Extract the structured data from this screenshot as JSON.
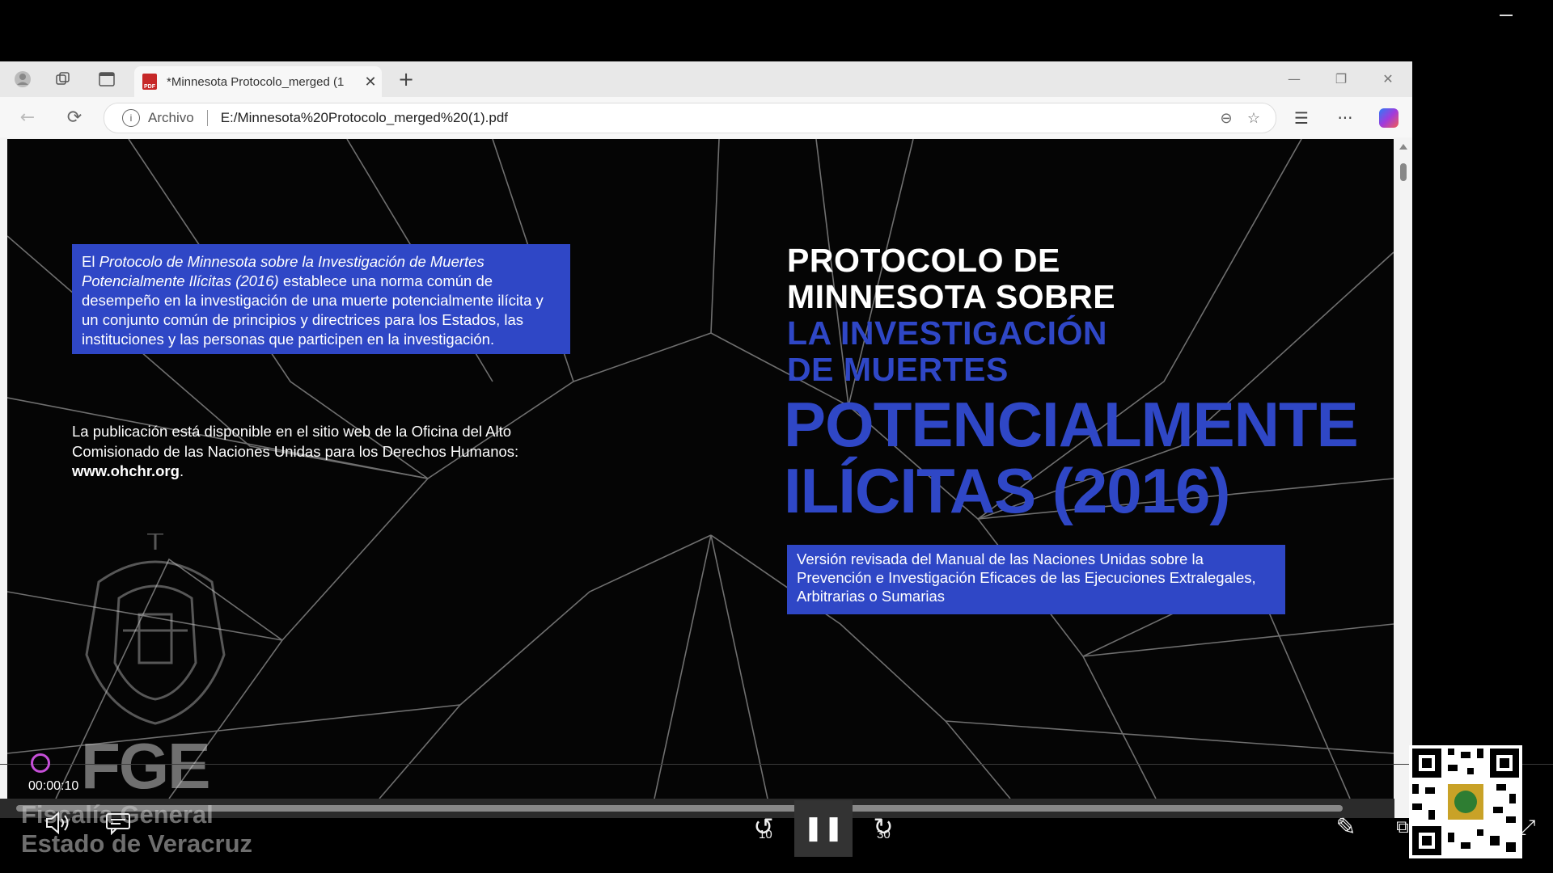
{
  "browser": {
    "tab_title": "*Minnesota Protocolo_merged (1",
    "url_scheme_label": "Archivo",
    "url": "E:/Minnesota%20Protocolo_merged%20(1).pdf"
  },
  "document": {
    "intro_box": {
      "prefix": "El ",
      "italic": "Protocolo de Minnesota sobre la Investigación de Muertes Potencialmente Ilícitas (2016)",
      "rest": " establece una norma común de desempeño en la investigación de una muerte potencialmente ilícita y un conjunto común de principios y directrices para los Estados, las instituciones y las personas que participen en la investigación."
    },
    "publication": {
      "text": "La publicación está disponible en el sitio web de la Oficina del Alto Comisionado de las Naciones Unidas para los Derechos Humanos:",
      "link": "www.ohchr.org",
      "suffix": "."
    },
    "title": {
      "line1": "PROTOCOLO DE",
      "line2": "MINNESOTA SOBRE",
      "line3": "LA INVESTIGACIÓN",
      "line4": "DE MUERTES",
      "line5": "POTENCIALMENTE",
      "line6": "ILÍCITAS (2016)"
    },
    "version_box": "Versión revisada del Manual de las Naciones Unidas sobre la Prevención e Investigación Eficaces de las Ejecuciones Extralegales, Arbitrarias o Sumarias"
  },
  "watermark": {
    "acronym": "FGE",
    "line1": "Fiscalía General",
    "line2": "Estado de Veracruz"
  },
  "player": {
    "time": "00:00:10",
    "rewind_seconds": "10",
    "forward_seconds": "30"
  },
  "colors": {
    "accent_blue": "#2f47c6",
    "progress_ring": "#c64fd8"
  }
}
